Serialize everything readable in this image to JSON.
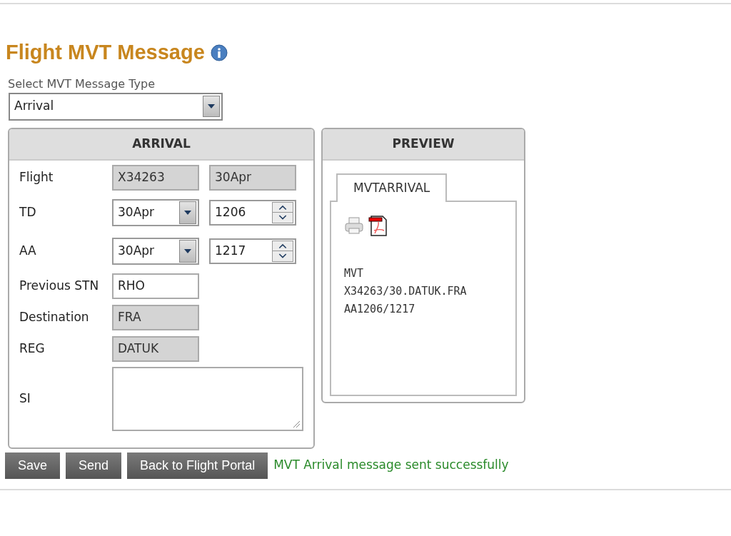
{
  "title": "Flight MVT Message",
  "type_select": {
    "label": "Select MVT Message Type",
    "value": "Arrival"
  },
  "form_panel": {
    "title": "ARRIVAL",
    "rows": [
      {
        "kind": "readonly_pair",
        "label": "Flight",
        "values": [
          "X34263",
          "30Apr"
        ]
      },
      {
        "kind": "date_time",
        "label": "TD",
        "date": "30Apr",
        "time": "1206"
      },
      {
        "kind": "date_time",
        "label": "AA",
        "date": "30Apr",
        "time": "1217"
      },
      {
        "kind": "text",
        "label": "Previous STN",
        "value": "RHO"
      },
      {
        "kind": "readonly",
        "label": "Destination",
        "value": "FRA"
      },
      {
        "kind": "readonly",
        "label": "REG",
        "value": "DATUK"
      },
      {
        "kind": "textarea",
        "label": "SI"
      }
    ]
  },
  "preview_panel": {
    "title": "PREVIEW",
    "tabs": [
      {
        "label": "MVTARRIVAL",
        "selected": true
      }
    ],
    "message_lines": [
      "MVT",
      "X34263/30.DATUK.FRA",
      "AA1206/1217"
    ]
  },
  "buttons": [
    "Save",
    "Send",
    "Back to Flight Portal"
  ],
  "status_message": "MVT Arrival message sent successfully"
}
